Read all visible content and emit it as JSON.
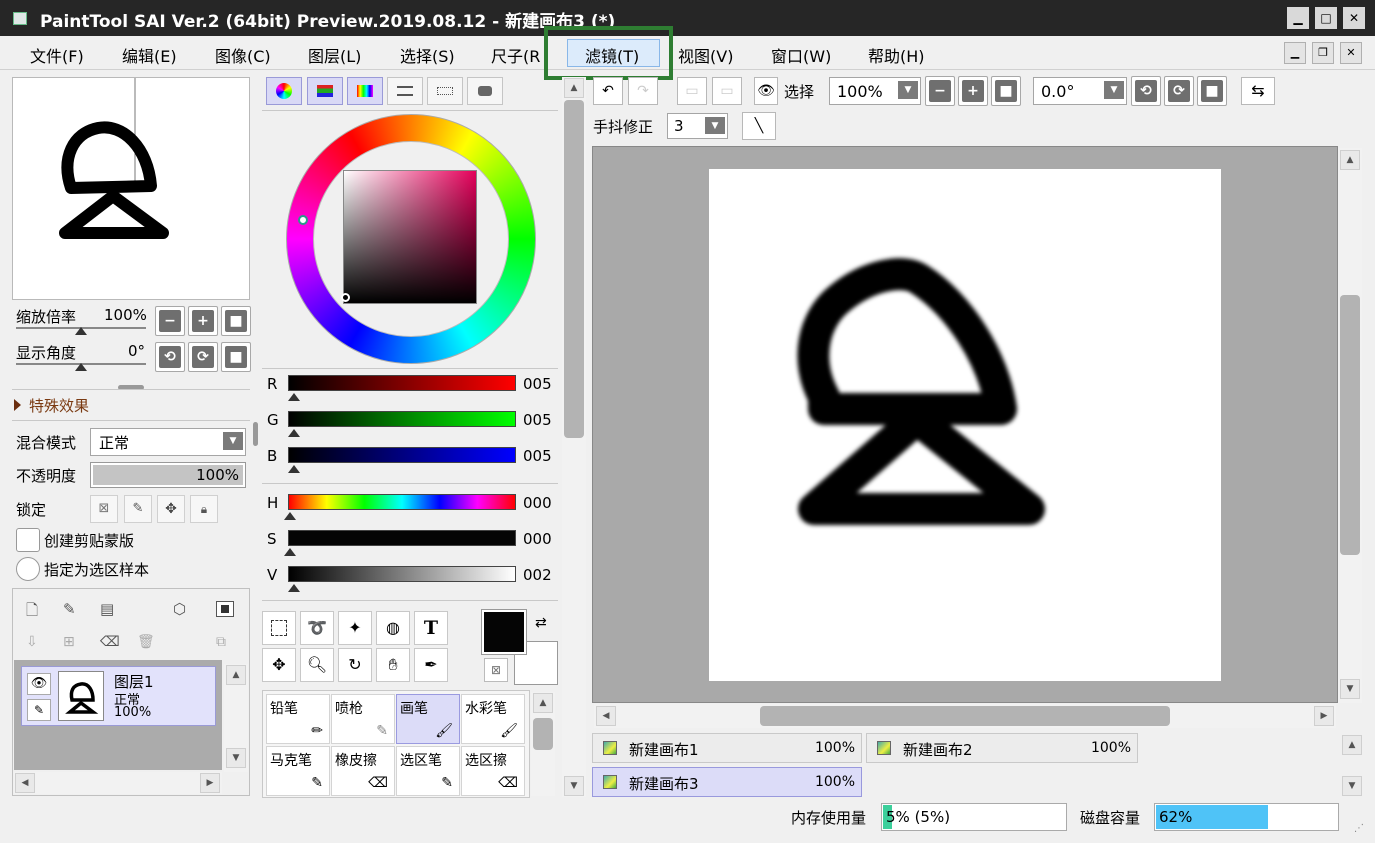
{
  "window": {
    "title": "PaintTool SAI Ver.2 (64bit) Preview.2019.08.12 - 新建画布3 (*)"
  },
  "title_buttons": {
    "minimize": "▁",
    "maximize": "□",
    "close": "✕"
  },
  "menu": [
    {
      "label": "文件(F)"
    },
    {
      "label": "编辑(E)"
    },
    {
      "label": "图像(C)"
    },
    {
      "label": "图层(L)"
    },
    {
      "label": "选择(S)"
    },
    {
      "label": "尺子(R"
    },
    {
      "label": "滤镜(T)"
    },
    {
      "label": "视图(V)"
    },
    {
      "label": "窗口(W)"
    },
    {
      "label": "帮助(H)"
    }
  ],
  "navigator": {
    "zoom_label": "缩放倍率",
    "zoom_value": "100%",
    "angle_label": "显示角度",
    "angle_value": "0°"
  },
  "layer_props": {
    "effects_label": "特殊效果",
    "blend_label": "混合模式",
    "blend_value": "正常",
    "opacity_label": "不透明度",
    "opacity_value": "100%",
    "lock_label": "锁定",
    "clip_label": "创建剪贴蒙版",
    "sample_label": "指定为选区样本"
  },
  "layers": [
    {
      "name": "图层1",
      "mode": "正常",
      "opacity": "100%"
    }
  ],
  "color": {
    "sliders": [
      {
        "label": "R",
        "value": "005"
      },
      {
        "label": "G",
        "value": "005"
      },
      {
        "label": "B",
        "value": "005"
      },
      {
        "label": "H",
        "value": "000"
      },
      {
        "label": "S",
        "value": "000"
      },
      {
        "label": "V",
        "value": "002"
      }
    ],
    "foreground": "#050505",
    "background": "#ffffff"
  },
  "tools": {
    "text_tool_glyph": "T"
  },
  "brushes": [
    {
      "label": "铅笔"
    },
    {
      "label": "喷枪"
    },
    {
      "label": "画笔"
    },
    {
      "label": "水彩笔"
    },
    {
      "label": "马克笔"
    },
    {
      "label": "橡皮擦"
    },
    {
      "label": "选区笔"
    },
    {
      "label": "选区擦"
    }
  ],
  "canvas_toolbar": {
    "select_label": "选择",
    "zoom_value": "100%",
    "rotate_value": "0.0°",
    "stabilizer_label": "手抖修正",
    "stabilizer_value": "3"
  },
  "tabs": [
    {
      "name": "新建画布1",
      "zoom": "100%"
    },
    {
      "name": "新建画布2",
      "zoom": "100%"
    },
    {
      "name": "新建画布3",
      "zoom": "100%"
    }
  ],
  "status": {
    "memory_label": "内存使用量",
    "memory_value": "5% (5%)",
    "memory_fraction": 0.05,
    "disk_label": "磁盘容量",
    "disk_value": "62%",
    "disk_fraction": 0.62
  }
}
